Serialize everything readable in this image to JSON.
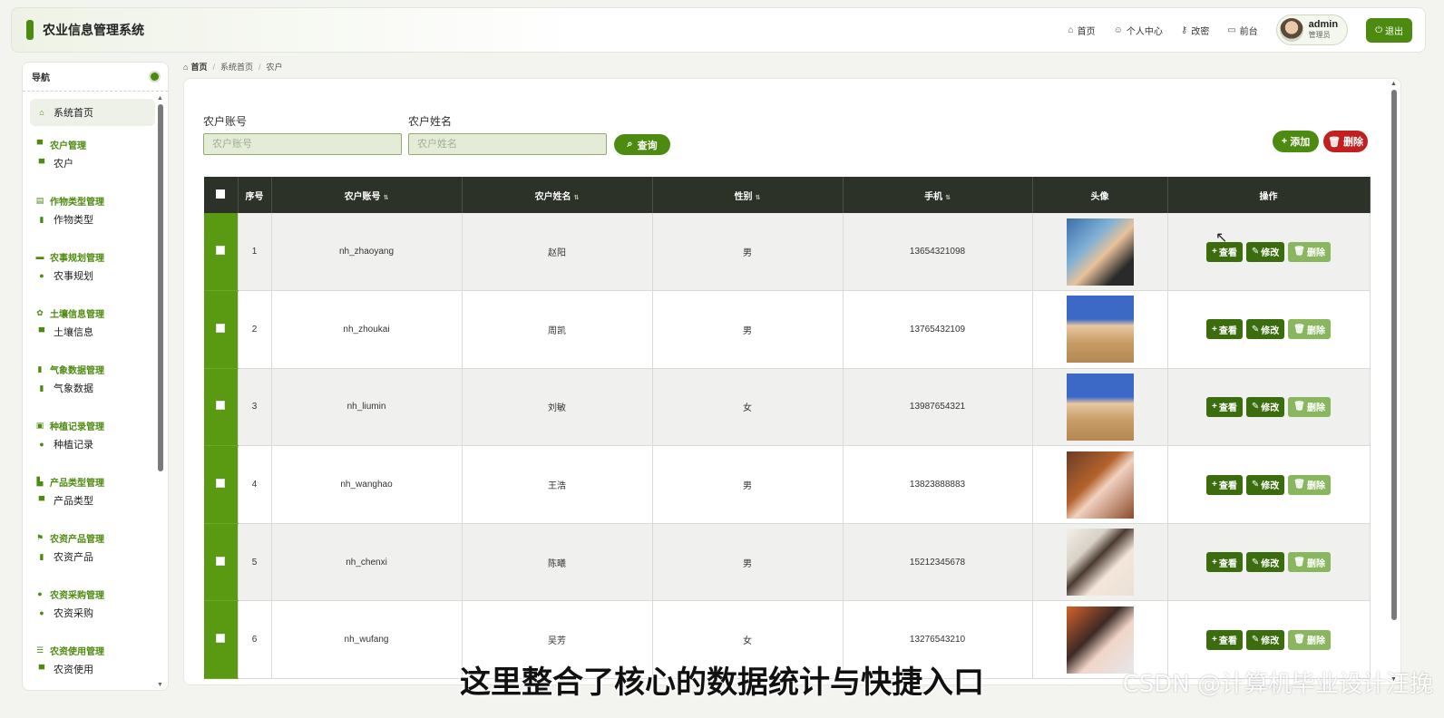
{
  "header": {
    "title": "农业信息管理系统",
    "nav": [
      {
        "icon": "home-icon",
        "glyph": "⌂",
        "label": "首页"
      },
      {
        "icon": "user-icon",
        "glyph": "☺",
        "label": "个人中心"
      },
      {
        "icon": "key-icon",
        "glyph": "⚷",
        "label": "改密"
      },
      {
        "icon": "monitor-icon",
        "glyph": "▭",
        "label": "前台"
      }
    ],
    "user": {
      "name": "admin",
      "role": "管理员"
    },
    "logout_label": "退出"
  },
  "sidebar": {
    "title": "导航",
    "home_label": "系统首页",
    "groups": [
      {
        "title": "农户管理",
        "item": "农户"
      },
      {
        "title": "作物类型管理",
        "item": "作物类型"
      },
      {
        "title": "农事规划管理",
        "item": "农事规划"
      },
      {
        "title": "土壤信息管理",
        "item": "土壤信息"
      },
      {
        "title": "气象数据管理",
        "item": "气象数据"
      },
      {
        "title": "种植记录管理",
        "item": "种植记录"
      },
      {
        "title": "产品类型管理",
        "item": "产品类型"
      },
      {
        "title": "农资产品管理",
        "item": "农资产品"
      },
      {
        "title": "农资采购管理",
        "item": "农资采购"
      },
      {
        "title": "农资使用管理",
        "item": "农资使用"
      }
    ]
  },
  "breadcrumb": {
    "home": "首页",
    "level1": "系统首页",
    "level2": "农户"
  },
  "search": {
    "account_label": "农户账号",
    "account_placeholder": "农户账号",
    "name_label": "农户姓名",
    "name_placeholder": "农户姓名",
    "query_label": "查询"
  },
  "actions": {
    "add_label": "添加",
    "delete_label": "删除"
  },
  "table": {
    "columns": [
      "序号",
      "农户账号",
      "农户姓名",
      "性别",
      "手机",
      "头像",
      "操作"
    ],
    "rows": [
      {
        "index": "1",
        "account": "nh_zhaoyang",
        "name": "赵阳",
        "gender": "男",
        "phone": "13654321098"
      },
      {
        "index": "2",
        "account": "nh_zhoukai",
        "name": "周凯",
        "gender": "男",
        "phone": "13765432109"
      },
      {
        "index": "3",
        "account": "nh_liumin",
        "name": "刘敏",
        "gender": "女",
        "phone": "13987654321"
      },
      {
        "index": "4",
        "account": "nh_wanghao",
        "name": "王浩",
        "gender": "男",
        "phone": "13823888883"
      },
      {
        "index": "5",
        "account": "nh_chenxi",
        "name": "陈曦",
        "gender": "男",
        "phone": "15212345678"
      },
      {
        "index": "6",
        "account": "nh_wufang",
        "name": "吴芳",
        "gender": "女",
        "phone": "13276543210"
      }
    ],
    "op_view": "查看",
    "op_edit": "修改",
    "op_delete": "删除"
  },
  "overlay": {
    "caption": "这里整合了核心的数据统计与快捷入口",
    "watermark": "CSDN @计算机毕业设计汪挽"
  },
  "colors": {
    "accent": "#4d8a10",
    "danger": "#c21f1f",
    "table_head": "#2c3227"
  }
}
